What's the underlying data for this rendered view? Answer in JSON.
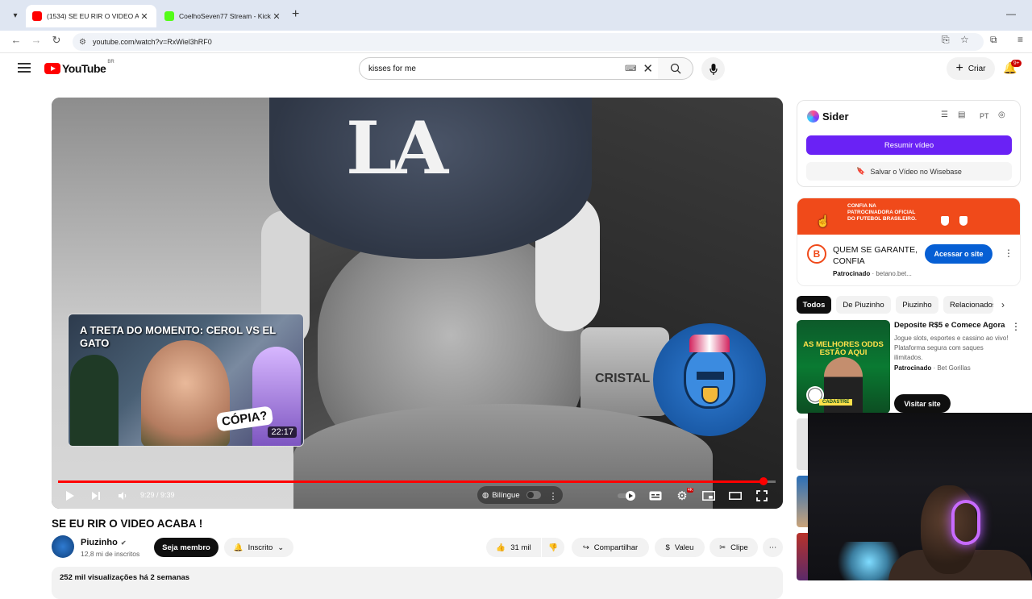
{
  "browser": {
    "tabs": [
      {
        "title": "(1534) SE EU RIR O VIDEO A",
        "active": true
      },
      {
        "title": "CoelhoSeven77 Stream - Kick",
        "active": false
      }
    ],
    "url": "youtube.com/watch?v=RxWiel3hRF0"
  },
  "header": {
    "logo_text": "YouTube",
    "region": "BR",
    "search_value": "kisses for me",
    "create_label": "Criar",
    "notifications_badge": "9+"
  },
  "player": {
    "endcard_title": "A TRETA DO MOMENTO: CEROL VS EL GATO",
    "endcard_sticker": "CÓPIA?",
    "endcard_duration": "22:17",
    "background_text": "CRISTAL",
    "cap_logo": "LA",
    "time": "9:29 / 9:39",
    "progress": 0.983,
    "bilingual_label": "Bilíngue",
    "hd_badge": "4K"
  },
  "video": {
    "title": "SE EU RIR O VIDEO ACABA !",
    "channel": "Piuzinho",
    "subscribers": "12,8 mi de inscritos",
    "member_button": "Seja membro",
    "subscribed_button": "Inscrito",
    "likes": "31 mil",
    "share_label": "Compartilhar",
    "thanks_label": "Valeu",
    "clip_label": "Clipe",
    "stats": "252 mil visualizações  há 2 semanas"
  },
  "sider": {
    "name": "Sider",
    "lang": "PT",
    "summarize_button": "Resumir vídeo",
    "save_button": "Salvar o Vídeo no Wisebase"
  },
  "ad": {
    "banner_text": "CONFIA NA PATROCINADORA OFICIAL DO FUTEBOL BRASILEIRO.",
    "headline": "QUEM SE GARANTE, CONFIA",
    "sponsored": "Patrocinado",
    "domain": "betano.bet...",
    "cta": "Acessar o site"
  },
  "chips": [
    "Todos",
    "De Piuzinho",
    "Piuzinho",
    "Relacionados"
  ],
  "promo": {
    "thumb_text": "AS MELHORES ODDS ESTÃO AQUI",
    "thumb_cta": "CADASTRE",
    "title": "Deposite R$5 e Comece Agora",
    "description": "Jogue slots, esportes e cassino ao vivo! Plataforma segura com saques ilimitados.",
    "sponsored": "Patrocinado",
    "advertiser": "Bet Gorillas",
    "cta": "Visitar site"
  },
  "colors": {
    "youtube_red": "#ff0000",
    "sider_purple": "#6a22f5",
    "ad_orange": "#f04a1a",
    "link_blue": "#065fd4"
  }
}
